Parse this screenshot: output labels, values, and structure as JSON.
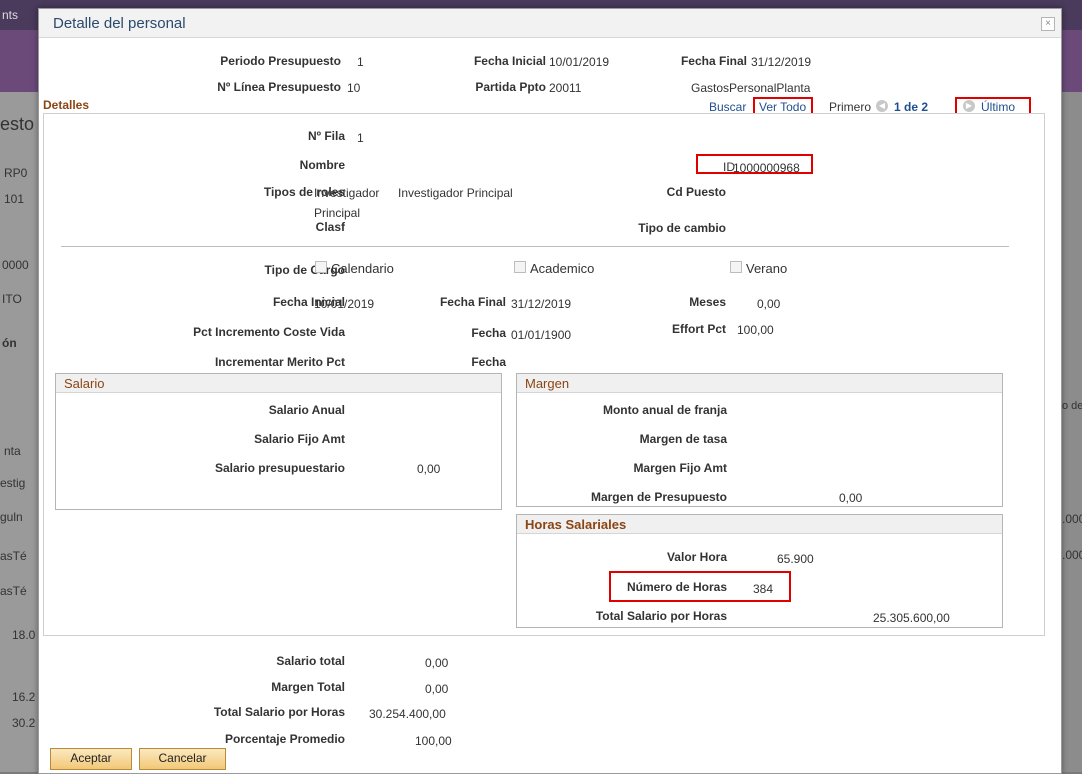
{
  "background": {
    "top_tab": "nts",
    "left_fragments": [
      "esto",
      "RP0",
      "101",
      "0000",
      "ITO",
      "ón",
      "nta",
      "estig",
      "guln",
      "asTé",
      "asTé",
      "18.0",
      "16.2",
      "30.2"
    ],
    "right_fragments": [
      "o de",
      ".000",
      ".000"
    ]
  },
  "modal": {
    "title": "Detalle del personal",
    "close_icon": "×"
  },
  "header": {
    "periodo_label": "Periodo Presupuesto",
    "periodo_value": "1",
    "fecha_inicial_label": "Fecha Inicial",
    "fecha_inicial_value": "10/01/2019",
    "fecha_final_label": "Fecha Final",
    "fecha_final_value": "31/12/2019",
    "linea_label": "Nº Línea Presupuesto",
    "linea_value": "10",
    "partida_label": "Partida Ppto",
    "partida_value": "20011",
    "partida_desc": "GastosPersonalPlanta"
  },
  "detalles": {
    "title": "Detalles",
    "buscar": "Buscar",
    "ver_todo": "Ver Todo",
    "primero": "Primero",
    "pager": "1 de 2",
    "ultimo": "Último"
  },
  "row": {
    "fila_label": "Nº Fila",
    "fila_value": "1",
    "nombre_label": "Nombre",
    "id_label": "ID",
    "id_value": "1000000968",
    "roles_label": "Tipos de roles",
    "roles_value1": "Investigador",
    "roles_value1b": "Principal",
    "roles_value2": "Investigador Principal",
    "cd_puesto_label": "Cd Puesto",
    "clasf_label": "Clasf",
    "tipo_cambio_label": "Tipo de cambio"
  },
  "cargo": {
    "label": "Tipo de Cargo",
    "options": [
      "Calendario",
      "Academico",
      "Verano"
    ],
    "fecha_inicial_label": "Fecha Inicial",
    "fecha_inicial_value": "10/01/2019",
    "fecha_final_label": "Fecha Final",
    "fecha_final_value": "31/12/2019",
    "meses_label": "Meses",
    "meses_value": "0,00",
    "pct_label": "Pct Incremento Coste Vida",
    "fecha_label": "Fecha",
    "fecha_value": "01/01/1900",
    "effort_label": "Effort Pct",
    "effort_value": "100,00",
    "merito_label": "Incrementar Merito Pct",
    "fecha2_label": "Fecha"
  },
  "salario": {
    "title": "Salario",
    "anual_label": "Salario Anual",
    "fijo_label": "Salario Fijo Amt",
    "presupuestario_label": "Salario presupuestario",
    "presupuestario_value": "0,00"
  },
  "margen": {
    "title": "Margen",
    "franja_label": "Monto anual de franja",
    "tasa_label": "Margen de tasa",
    "fijo_label": "Margen Fijo Amt",
    "presupuesto_label": "Margen de Presupuesto",
    "presupuesto_value": "0,00"
  },
  "horas": {
    "title": "Horas Salariales",
    "valor_label": "Valor Hora",
    "valor_value": "65.900",
    "numero_label": "Número de Horas",
    "numero_value": "384",
    "total_label": "Total Salario por Horas",
    "total_value": "25.305.600,00"
  },
  "totals": {
    "salario_total_label": "Salario total",
    "salario_total_value": "0,00",
    "margen_total_label": "Margen Total",
    "margen_total_value": "0,00",
    "total_horas_label": "Total Salario por Horas",
    "total_horas_value": "30.254.400,00",
    "porcentaje_label": "Porcentaje Promedio",
    "porcentaje_value": "100,00"
  },
  "buttons": {
    "aceptar": "Aceptar",
    "cancelar": "Cancelar"
  },
  "colors": {
    "section_header": "#8b4513",
    "link": "#1f4f8f",
    "highlight": "#e00000",
    "button": "#f2c878"
  }
}
